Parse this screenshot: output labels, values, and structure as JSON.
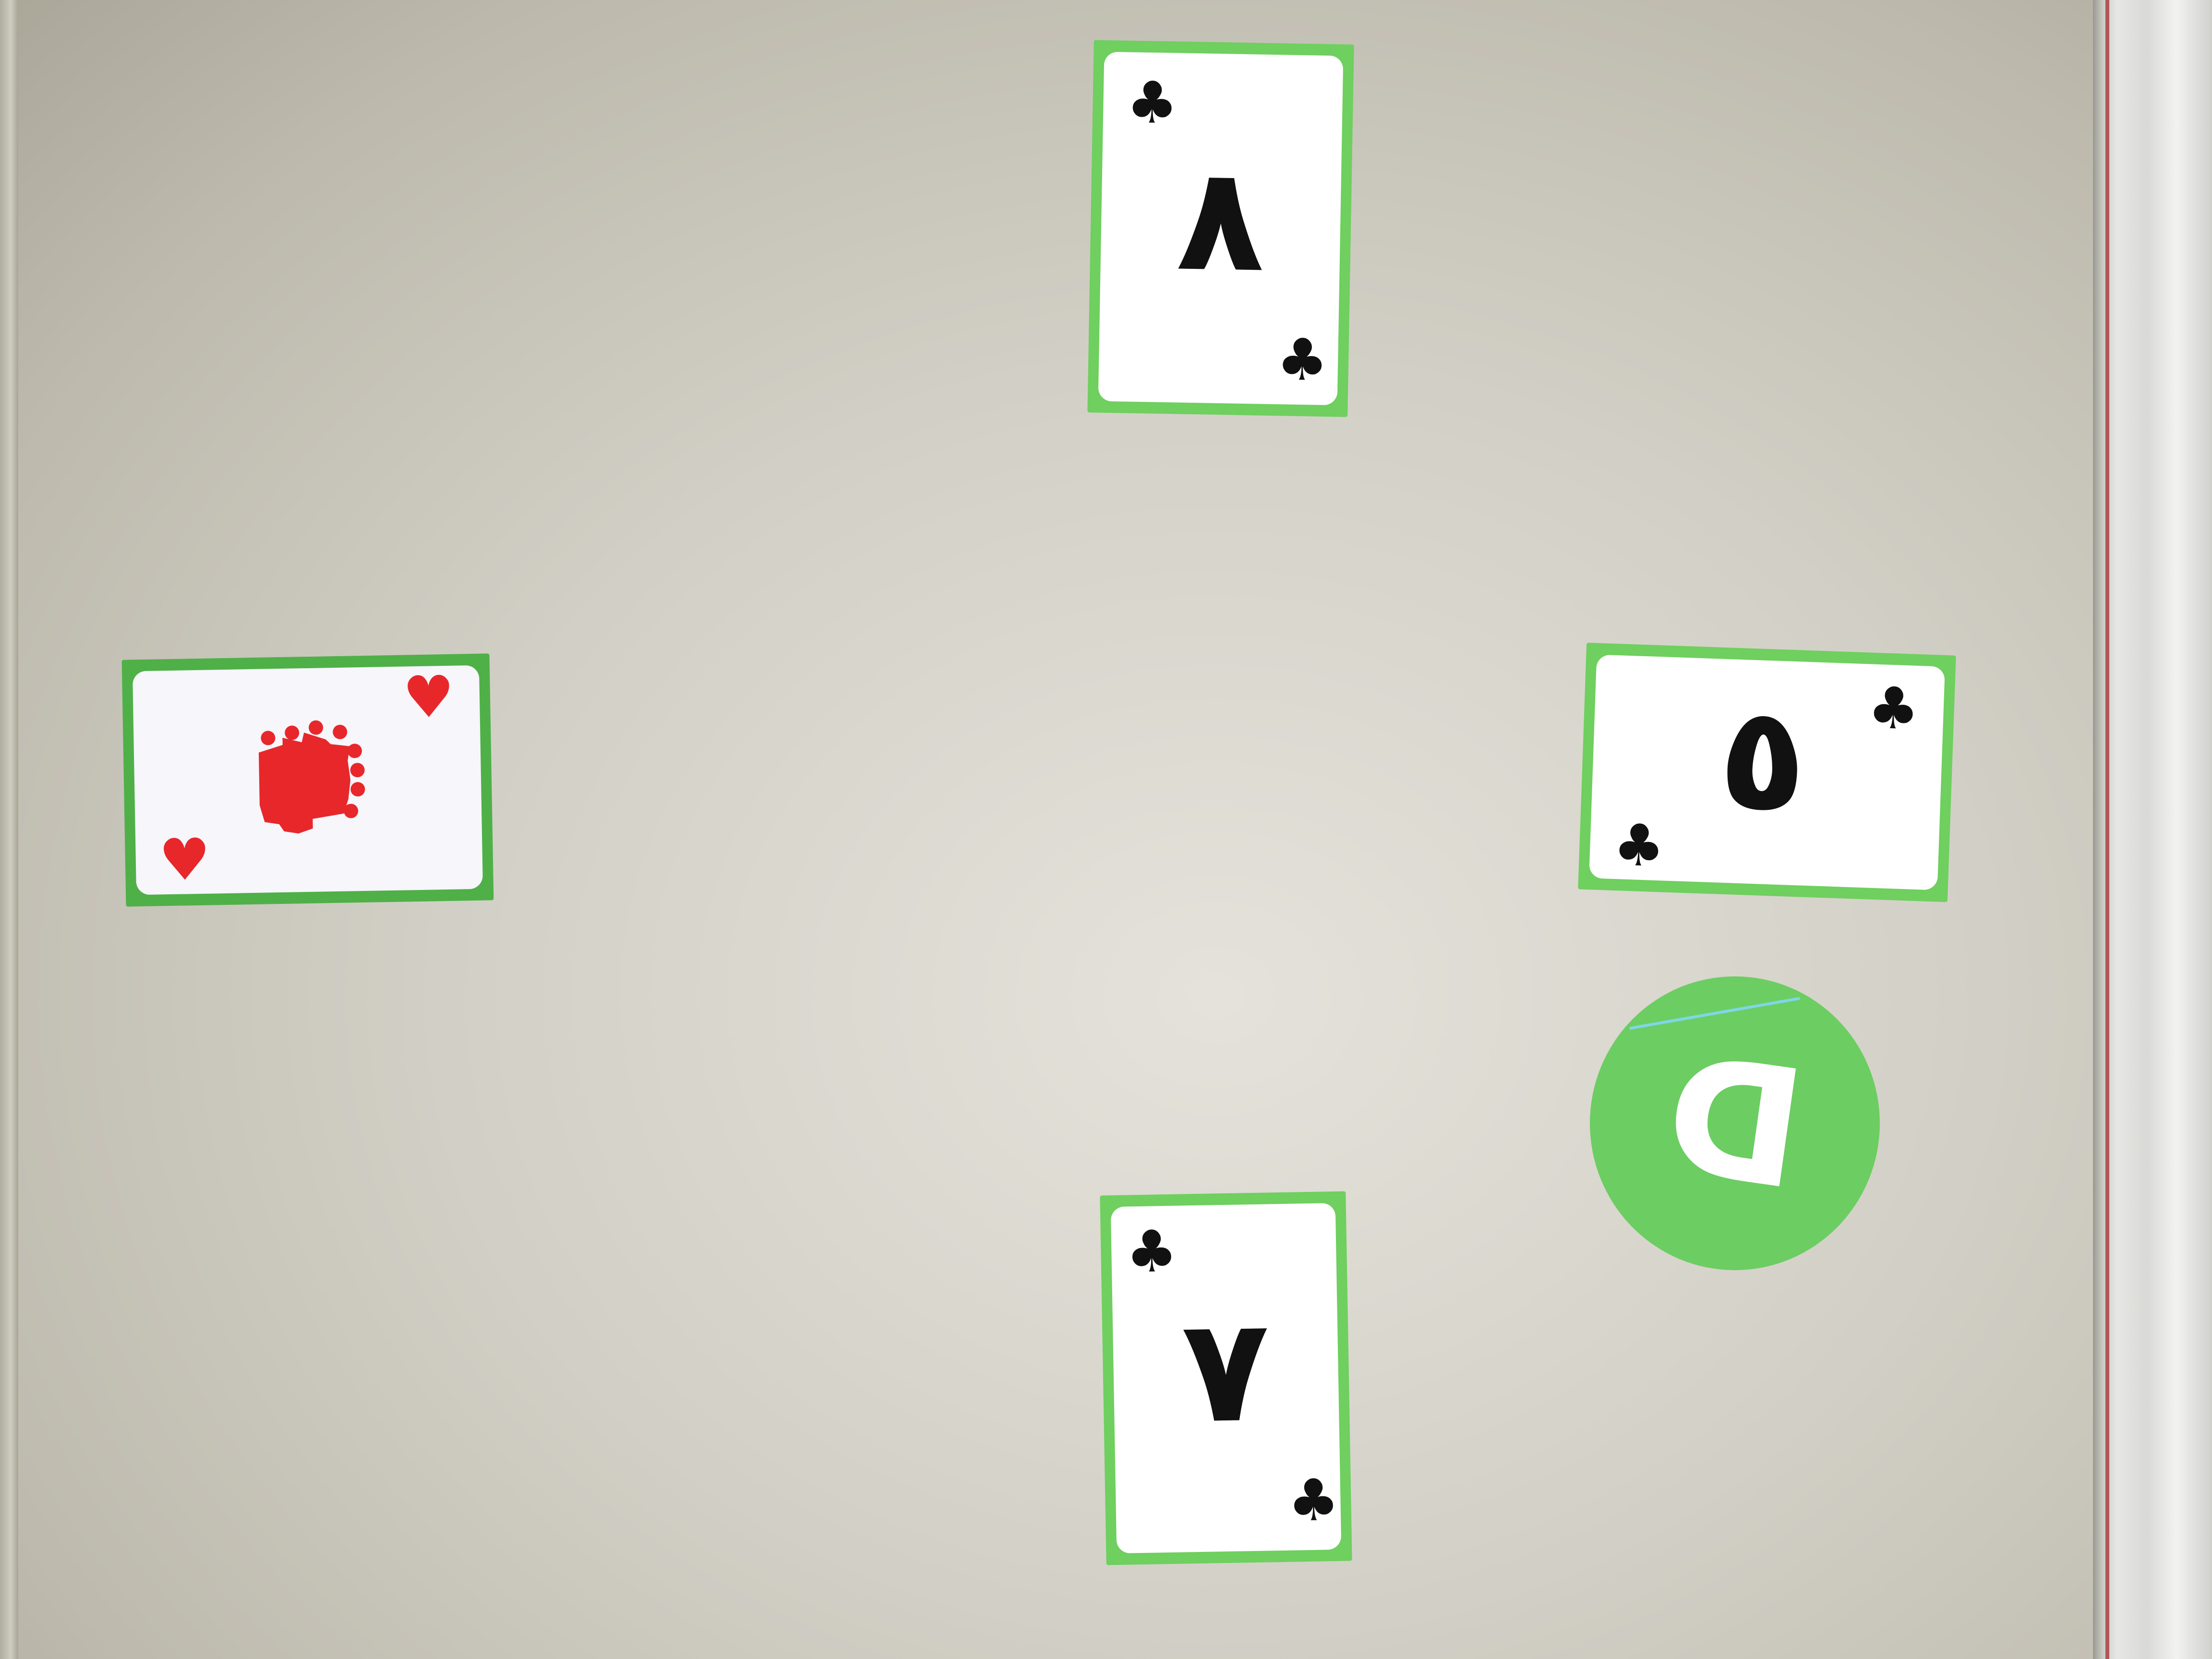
{
  "board": {
    "background": "#d4d2c8",
    "card_border_color": "#6fcf5f",
    "black_suit_color": "#111111",
    "red_suit_color": "#e8272b"
  },
  "cards": [
    {
      "name": "north",
      "rank_glyph": "٨",
      "suit": "clubs",
      "suit_symbol": "♣"
    },
    {
      "name": "west",
      "rank_glyph": "crown",
      "suit": "hearts",
      "suit_symbol": "♥"
    },
    {
      "name": "east",
      "rank_glyph": "٥",
      "suit": "clubs",
      "suit_symbol": "♣"
    },
    {
      "name": "south",
      "rank_glyph": "٧",
      "suit": "clubs",
      "suit_symbol": "♣"
    }
  ],
  "dealer_button": {
    "label": "D",
    "color": "#6ccd62"
  }
}
